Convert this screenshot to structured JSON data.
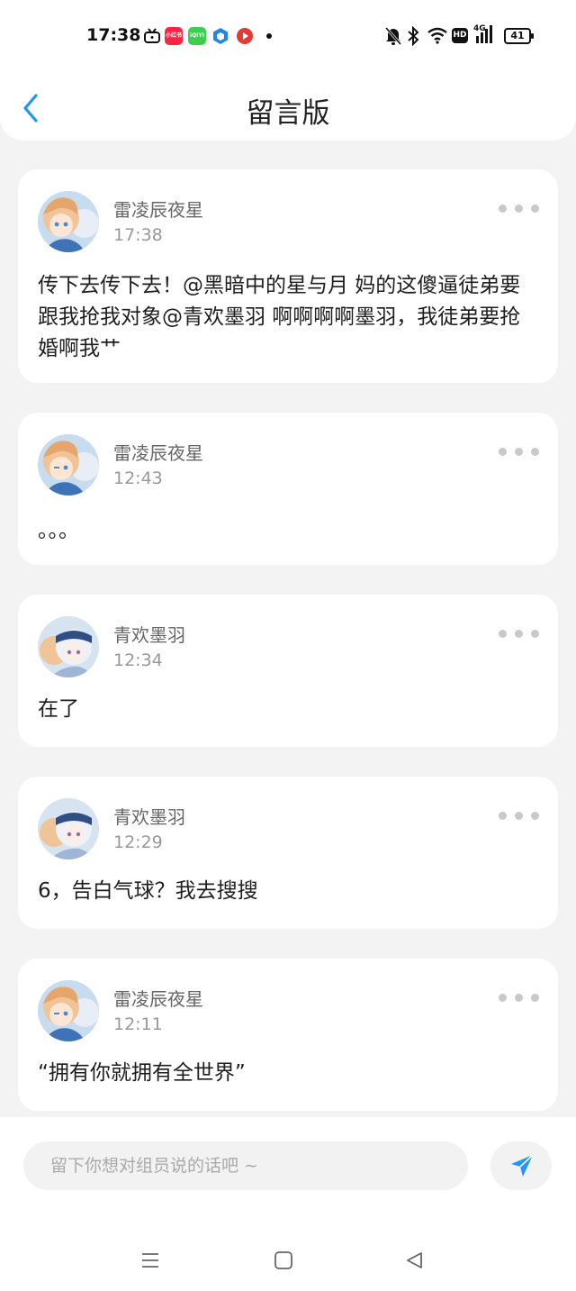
{
  "status_bar": {
    "time": "17:38",
    "app_icons": [
      "tv-icon",
      "xiaohongshu-app-icon",
      "iqiyi-app-icon",
      "cube-app-icon",
      "video-app-icon"
    ],
    "app_badges": [
      "",
      "小红书",
      "iQIYI",
      "",
      ""
    ],
    "right_icons": [
      "mute-bell-icon",
      "bluetooth-icon",
      "wifi-icon",
      "hd-icon",
      "signal-4g-icon"
    ],
    "hd_label": "HD",
    "network_label": "4G",
    "battery": "41"
  },
  "header": {
    "title": "留言版"
  },
  "messages": [
    {
      "author": "雷凌辰夜星",
      "time": "17:38",
      "text": "传下去传下去！@黑暗中的星与月 妈的这傻逼徒弟要跟我抢我对象@青欢墨羽 啊啊啊啊墨羽，我徒弟要抢婚啊我艹"
    },
    {
      "author": "雷凌辰夜星",
      "time": "12:43",
      "text": "。。。"
    },
    {
      "author": "青欢墨羽",
      "time": "12:34",
      "text": "在了"
    },
    {
      "author": "青欢墨羽",
      "time": "12:29",
      "text": "6，告白气球？我去搜搜"
    },
    {
      "author": "雷凌辰夜星",
      "time": "12:11",
      "text": "“拥有你就拥有全世界”"
    }
  ],
  "composer": {
    "placeholder": "留下你想对组员说的话吧 ~",
    "value": ""
  },
  "colors": {
    "accent": "#2196f3",
    "background": "#f3f3f3",
    "card": "#ffffff",
    "more_dots": "#c9c9c9"
  }
}
